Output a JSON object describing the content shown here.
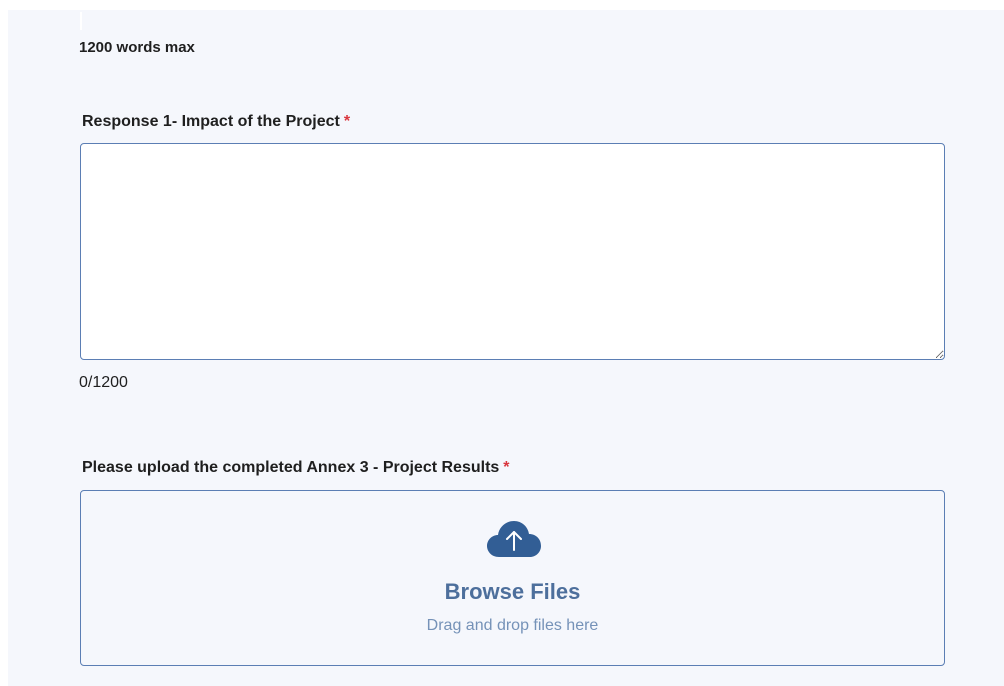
{
  "form": {
    "word_limit_hint": "1200 words max",
    "response_field": {
      "label": "Response 1- Impact of the Project",
      "required_marker": "*",
      "value": "",
      "counter": "0/1200"
    },
    "upload_field": {
      "label": "Please upload the completed Annex 3 - Project Results",
      "required_marker": "*",
      "icon": "cloud-upload-icon",
      "browse_label": "Browse Files",
      "drag_hint": "Drag and drop files here"
    }
  },
  "colors": {
    "panel_background": "#f5f7fc",
    "border": "#5b7eb4",
    "accent": "#325e95",
    "required": "#d9363e"
  }
}
